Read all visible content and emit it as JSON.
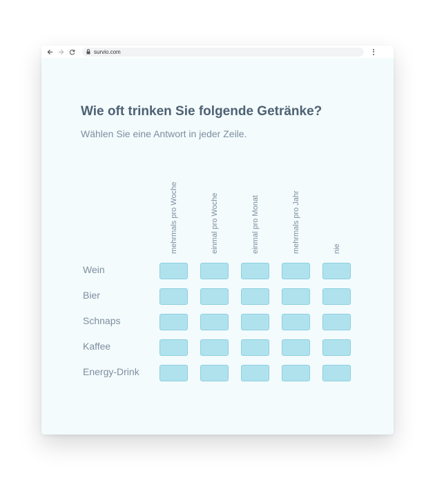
{
  "browser": {
    "url": "survio.com"
  },
  "survey": {
    "title": "Wie oft trinken Sie folgende Getränke?",
    "subtitle": "Wählen Sie eine Antwort in jeder Zeile.",
    "columns": [
      "mehrmals pro Woche",
      "einmal pro Woche",
      "einmal pro Monat",
      "mehrmals pro Jahr",
      "nie"
    ],
    "rows": [
      "Wein",
      "Bier",
      "Schnaps",
      "Kaffee",
      "Energy-Drink"
    ]
  },
  "colors": {
    "cell_fill": "#b0e2ee",
    "cell_border": "#8ccfdf",
    "page_background": "#f3fbfd",
    "title_text": "#4e6173",
    "label_text": "#7d8e9e"
  }
}
